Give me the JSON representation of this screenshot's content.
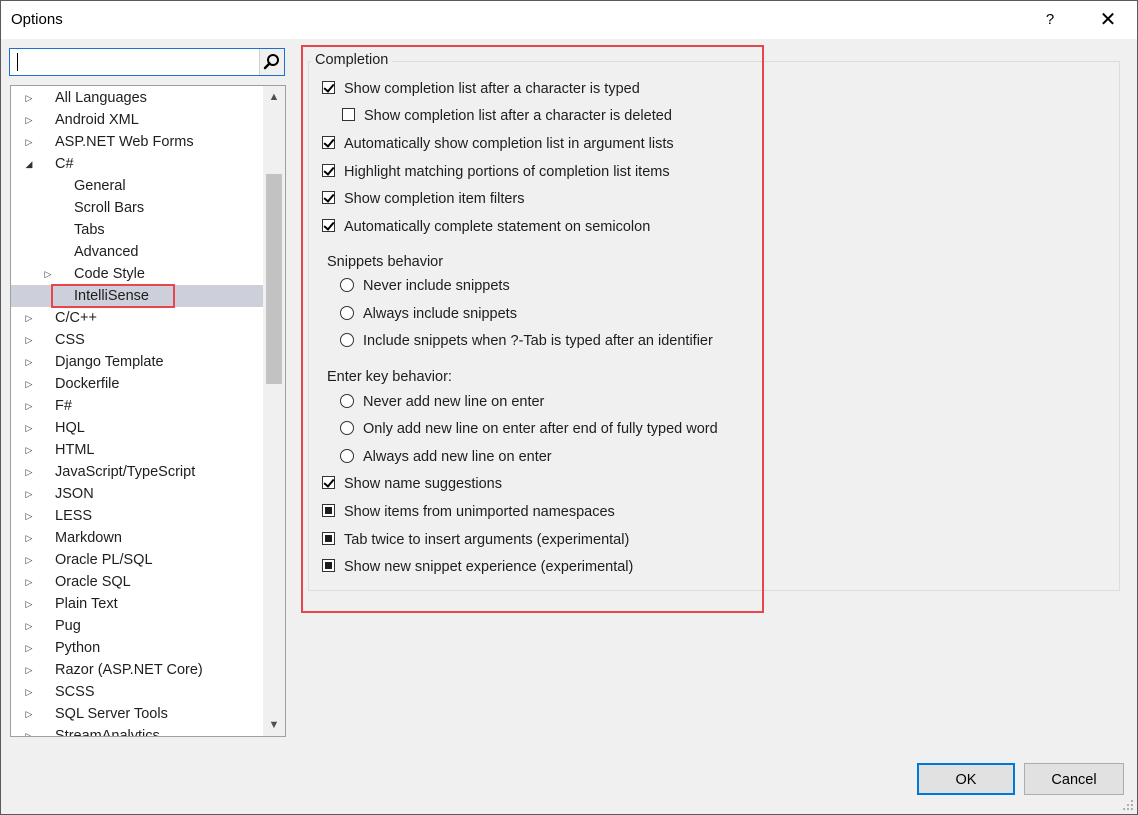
{
  "window": {
    "title": "Options",
    "help_label": "?",
    "close_label": "✕"
  },
  "search": {
    "value": "",
    "placeholder": ""
  },
  "tree": {
    "scroll_up": "▲",
    "scroll_down": "▼",
    "items": [
      {
        "label": "All Languages",
        "level": 0,
        "state": "collapsed"
      },
      {
        "label": "Android XML",
        "level": 0,
        "state": "collapsed"
      },
      {
        "label": "ASP.NET Web Forms",
        "level": 0,
        "state": "collapsed"
      },
      {
        "label": "C#",
        "level": 0,
        "state": "expanded"
      },
      {
        "label": "General",
        "level": 1,
        "state": "leaf"
      },
      {
        "label": "Scroll Bars",
        "level": 1,
        "state": "leaf"
      },
      {
        "label": "Tabs",
        "level": 1,
        "state": "leaf"
      },
      {
        "label": "Advanced",
        "level": 1,
        "state": "leaf"
      },
      {
        "label": "Code Style",
        "level": 1,
        "state": "collapsed"
      },
      {
        "label": "IntelliSense",
        "level": 1,
        "state": "leaf",
        "selected": true
      },
      {
        "label": "C/C++",
        "level": 0,
        "state": "collapsed"
      },
      {
        "label": "CSS",
        "level": 0,
        "state": "collapsed"
      },
      {
        "label": "Django Template",
        "level": 0,
        "state": "collapsed"
      },
      {
        "label": "Dockerfile",
        "level": 0,
        "state": "collapsed"
      },
      {
        "label": "F#",
        "level": 0,
        "state": "collapsed"
      },
      {
        "label": "HQL",
        "level": 0,
        "state": "collapsed"
      },
      {
        "label": "HTML",
        "level": 0,
        "state": "collapsed"
      },
      {
        "label": "JavaScript/TypeScript",
        "level": 0,
        "state": "collapsed"
      },
      {
        "label": "JSON",
        "level": 0,
        "state": "collapsed"
      },
      {
        "label": "LESS",
        "level": 0,
        "state": "collapsed"
      },
      {
        "label": "Markdown",
        "level": 0,
        "state": "collapsed"
      },
      {
        "label": "Oracle PL/SQL",
        "level": 0,
        "state": "collapsed"
      },
      {
        "label": "Oracle SQL",
        "level": 0,
        "state": "collapsed"
      },
      {
        "label": "Plain Text",
        "level": 0,
        "state": "collapsed"
      },
      {
        "label": "Pug",
        "level": 0,
        "state": "collapsed"
      },
      {
        "label": "Python",
        "level": 0,
        "state": "collapsed"
      },
      {
        "label": "Razor (ASP.NET Core)",
        "level": 0,
        "state": "collapsed"
      },
      {
        "label": "SCSS",
        "level": 0,
        "state": "collapsed"
      },
      {
        "label": "SQL Server Tools",
        "level": 0,
        "state": "collapsed"
      },
      {
        "label": "StreamAnalytics",
        "level": 0,
        "state": "collapsed"
      }
    ]
  },
  "completion": {
    "group_title": "Completion",
    "show_after_typed": {
      "label": "Show completion list after a character is typed",
      "state": "checked"
    },
    "show_after_deleted": {
      "label": "Show completion list after a character is deleted",
      "state": "unchecked"
    },
    "auto_show_arguments": {
      "label": "Automatically show completion list in argument lists",
      "state": "checked"
    },
    "highlight_matching": {
      "label": "Highlight matching portions of completion list items",
      "state": "checked"
    },
    "show_item_filters": {
      "label": "Show completion item filters",
      "state": "checked"
    },
    "auto_complete_semicolon": {
      "label": "Automatically complete statement on semicolon",
      "state": "checked"
    },
    "snippets": {
      "title": "Snippets behavior",
      "options": [
        {
          "label": "Never include snippets",
          "selected": false
        },
        {
          "label": "Always include snippets",
          "selected": false
        },
        {
          "label": "Include snippets when ?-Tab is typed after an identifier",
          "selected": false
        }
      ]
    },
    "enter_key": {
      "title": "Enter key behavior:",
      "options": [
        {
          "label": "Never add new line on enter",
          "selected": false
        },
        {
          "label": "Only add new line on enter after end of fully typed word",
          "selected": false
        },
        {
          "label": "Always add new line on enter",
          "selected": false
        }
      ]
    },
    "name_suggestions": {
      "label": "Show name suggestions",
      "state": "checked"
    },
    "unimported_namespaces": {
      "label": "Show items from unimported namespaces",
      "state": "indeterminate"
    },
    "tab_twice": {
      "label": "Tab twice to insert arguments (experimental)",
      "state": "indeterminate"
    },
    "new_snippet_experience": {
      "label": "Show new snippet experience (experimental)",
      "state": "indeterminate"
    }
  },
  "buttons": {
    "ok": "OK",
    "cancel": "Cancel"
  },
  "colors": {
    "highlight_frame": "#e8464f",
    "selection": "#cdd0db",
    "focus_border": "#0078d7"
  }
}
